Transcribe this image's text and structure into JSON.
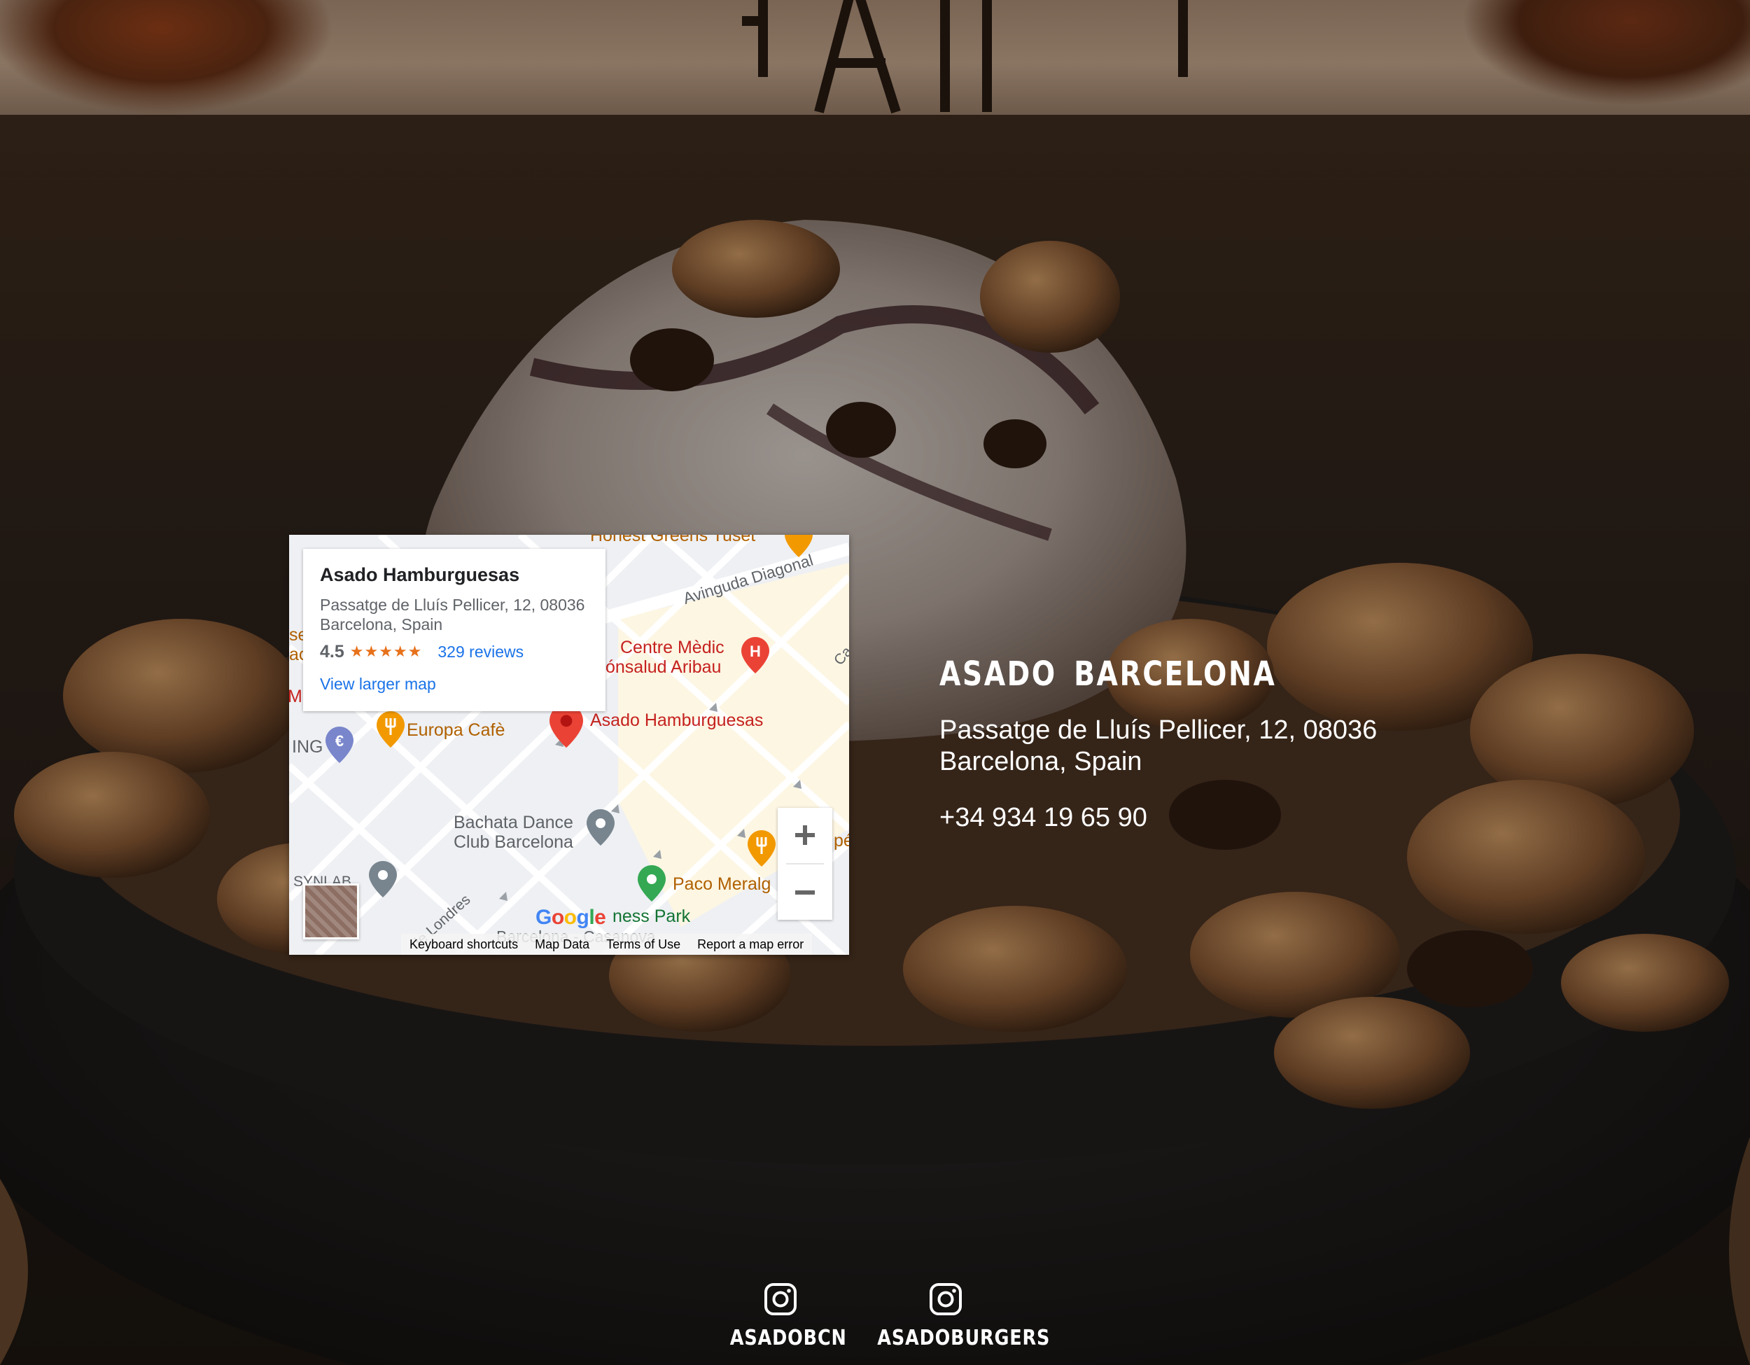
{
  "map": {
    "card": {
      "name": "Asado Hamburguesas",
      "address": "Passatge de Lluís Pellicer, 12, 08036 Barcelona, Spain",
      "rating": "4.5",
      "stars": "★★★★★",
      "reviews": "329 reviews",
      "larger_map": "View larger map"
    },
    "pois": {
      "honest_greens": "Honest Greens Tuset",
      "avinguda": "Avinguda Diagonal",
      "centre_medic": "Centre Mèdic",
      "fonsalud": "ónsalud Aribau",
      "europa": "Europa Cafè",
      "asado": "Asado Hamburguesas",
      "bachata_1": "Bachata Dance",
      "bachata_2": "Club Barcelona",
      "paco": "Paco Meralg",
      "synlab": "SYNLAB",
      "londres": "de Londres",
      "business_park": "ness Park",
      "barcelona_casanova": "Barcelona - Casanova",
      "ing": "ING",
      "ma": "Ma",
      "se": "se",
      "ac": "ac",
      "ca": "Ca",
      "pe": "pé"
    },
    "google": [
      "G",
      "o",
      "o",
      "g",
      "l",
      "e"
    ],
    "footer": {
      "shortcuts": "Keyboard shortcuts",
      "map_data": "Map Data",
      "terms": "Terms of Use",
      "report": "Report a map error"
    },
    "colors": {
      "road": "#ffffff",
      "land": "#eef0f3",
      "beige": "#fdf6e3",
      "pin_red": "#ea4335",
      "pin_orange": "#f29900",
      "pin_grey": "#78858f",
      "pin_green": "#34a853",
      "pin_blue": "#7986cb"
    }
  },
  "location": {
    "title": "ASADO BARCELONA",
    "address": "Passatge de Lluís Pellicer, 12, 08036 Barcelona, Spain",
    "phone": "+34 934 19 65 90"
  },
  "social": [
    {
      "label": "ASADOBCN",
      "icon": "instagram-icon"
    },
    {
      "label": "ASADOBURGERS",
      "icon": "instagram-icon"
    }
  ]
}
